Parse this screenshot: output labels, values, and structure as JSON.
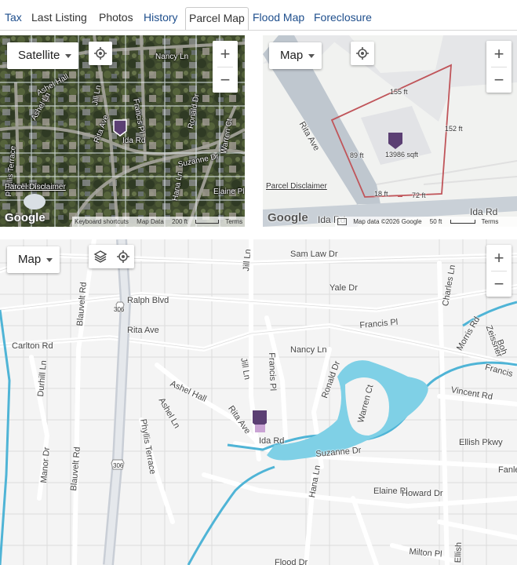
{
  "tabs": [
    {
      "label": "Tax",
      "active": false
    },
    {
      "label": "Last Listing",
      "active": false
    },
    {
      "label": "Photos",
      "active": false
    },
    {
      "label": "History",
      "active": false
    },
    {
      "label": "Parcel Map",
      "active": true
    },
    {
      "label": "Flood Map",
      "active": false
    },
    {
      "label": "Foreclosure",
      "active": false
    }
  ],
  "colors": {
    "tab_blue": "#1e4e8c",
    "marker": "#5b3f73",
    "parcel_line": "#c0555a",
    "water": "#7fd0e6",
    "stream": "#4fb4d6"
  },
  "satellite_map": {
    "type_label": "Satellite",
    "streets": [
      "Nancy Ln",
      "Jill Ln",
      "Francis Pl",
      "Ronald Dr",
      "Ashel Hall",
      "Ashel Ln",
      "Phyllis Terrace",
      "Rita Ave",
      "Ida Rd",
      "Suzanne Dr",
      "Warren Ct",
      "Hana Ln",
      "Elaine Pl",
      "Phyllis Terrace"
    ],
    "disclaimer": "Parcel Disclaimer",
    "logo": "Google",
    "attribution": {
      "shortcuts": "Keyboard shortcuts",
      "map_data": "Map Data",
      "scale": "200 ft",
      "terms": "Terms"
    }
  },
  "parcel_map": {
    "type_label": "Map",
    "streets": [
      "Rita Ave",
      "Ida Rd",
      "Ida Rd"
    ],
    "dimensions": {
      "top": "155 ft",
      "right": "152 ft",
      "left": "89 ft",
      "bottom_left": "18 ft",
      "bottom_right": "72 ft"
    },
    "area": "13986 sqft",
    "disclaimer": "Parcel Disclaimer",
    "logo": "Google",
    "attribution": {
      "map_data": "Map data ©2026 Google",
      "scale": "50 ft",
      "terms": "Terms"
    }
  },
  "area_map": {
    "type_label": "Map",
    "route_shields": [
      "306",
      "306"
    ],
    "streets": [
      "Sam Law Dr",
      "Jill Ln",
      "Yale Dr",
      "Charles Ln",
      "Ralph Blvd",
      "Blauvelt Rd",
      "Rita Ave",
      "Francis Pl",
      "Morris Rd",
      "Zeissner",
      "Boh",
      "Carlton Rd",
      "Nancy Ln",
      "Durhill Ln",
      "Francis Pl",
      "Francis",
      "Ronald Dr",
      "Vincent Rd",
      "Ashel Hall",
      "Ashel Ln",
      "Jill Ln",
      "Rita Ave",
      "Ida Rd",
      "Warren Ct",
      "Ellish Pkwy",
      "Phyllis Terrace",
      "Manor Dr",
      "Blauvelt Rd",
      "Suzanne Dr",
      "Fanle",
      "Hana Ln",
      "Elaine Pl",
      "Howard Dr",
      "Milton Pl",
      "Ellish",
      "Flood Dr"
    ]
  }
}
